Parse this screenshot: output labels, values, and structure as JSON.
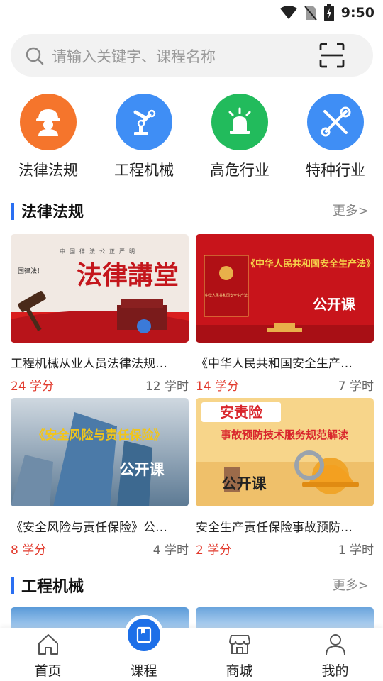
{
  "status": {
    "time": "9:50"
  },
  "search": {
    "placeholder": "请输入关键字、课程名称"
  },
  "categories": [
    {
      "label": "法律法规",
      "color": "#f5752c",
      "icon": "worker-helmet-icon"
    },
    {
      "label": "工程机械",
      "color": "#3f8ef5",
      "icon": "robot-arm-icon"
    },
    {
      "label": "高危行业",
      "color": "#22bb5c",
      "icon": "warning-light-icon"
    },
    {
      "label": "特种行业",
      "color": "#3f8ef5",
      "icon": "tools-icon"
    }
  ],
  "sections": [
    {
      "title": "法律法规",
      "more": "更多>",
      "courses": [
        {
          "title": "工程机械从业人员法律法规…",
          "credit": "24 学分",
          "hours": "12 学时",
          "banner": {
            "top": "中国律法公正严明",
            "main": "法律講堂",
            "badge": "国律法！"
          }
        },
        {
          "title": "《中华人民共和国安全生产…",
          "credit": "14 学分",
          "hours": "7 学时",
          "banner": {
            "main": "《中华人民共和国安全生产法》",
            "badge": "公开课",
            "book": "中华人民共和国安全生产法"
          }
        },
        {
          "title": "《安全风险与责任保险》公…",
          "credit": "8 学分",
          "hours": "4 学时",
          "banner": {
            "main": "《安全风险与责任保险》",
            "badge": "公开课"
          }
        },
        {
          "title": "安全生产责任保险事故预防…",
          "credit": "2 学分",
          "hours": "1 学时",
          "banner": {
            "top": "安责险",
            "main": "事故预防技术服务规范解读",
            "badge": "公开课"
          }
        }
      ]
    },
    {
      "title": "工程机械",
      "more": "更多>"
    }
  ],
  "tabbar": [
    {
      "label": "首页",
      "icon": "home-icon"
    },
    {
      "label": "课程",
      "icon": "book-icon",
      "active": true
    },
    {
      "label": "商城",
      "icon": "store-icon"
    },
    {
      "label": "我的",
      "icon": "user-icon"
    }
  ]
}
